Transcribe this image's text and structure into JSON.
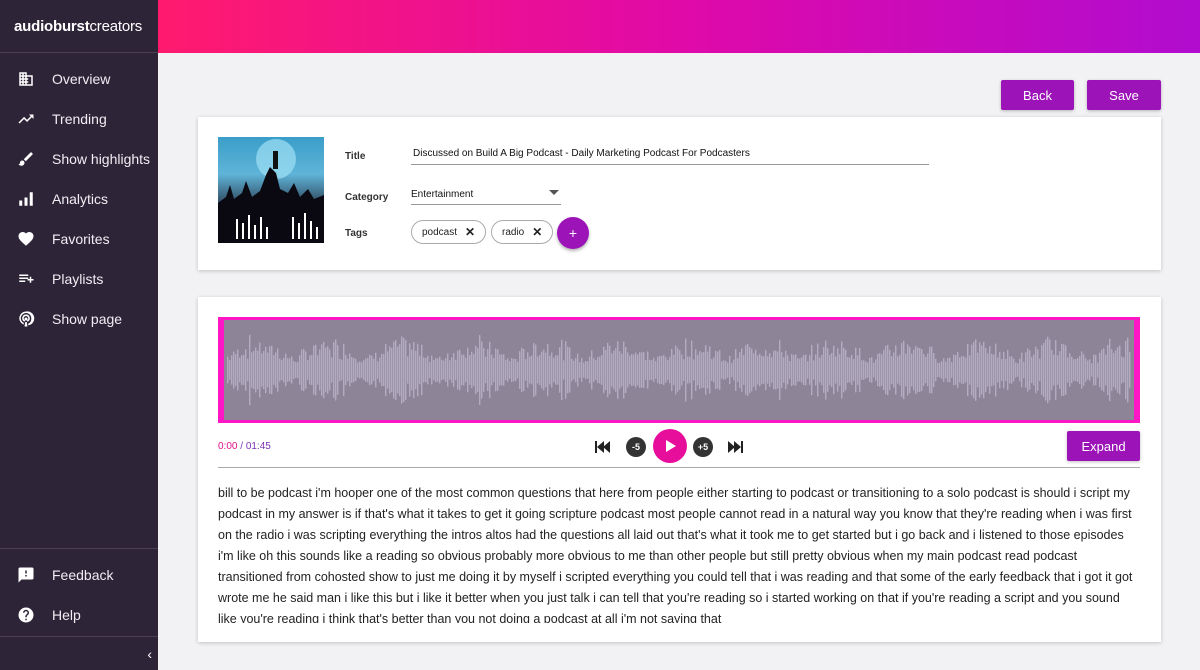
{
  "brand": {
    "name_bold": "audioburst",
    "name_light": "creators"
  },
  "sidebar": {
    "items": [
      {
        "label": "Overview",
        "icon": "building-icon"
      },
      {
        "label": "Trending",
        "icon": "trending-icon"
      },
      {
        "label": "Show highlights",
        "icon": "brush-icon"
      },
      {
        "label": "Analytics",
        "icon": "bar-chart-icon"
      },
      {
        "label": "Favorites",
        "icon": "heart-icon"
      },
      {
        "label": "Playlists",
        "icon": "playlist-add-icon"
      },
      {
        "label": "Show page",
        "icon": "podcast-icon"
      }
    ],
    "bottom": [
      {
        "label": "Feedback",
        "icon": "feedback-icon"
      },
      {
        "label": "Help",
        "icon": "help-icon"
      }
    ],
    "collapse_glyph": "‹"
  },
  "toolbar": {
    "back_label": "Back",
    "save_label": "Save"
  },
  "details": {
    "title_label": "Title",
    "title_value": "Discussed on Build A Big Podcast - Daily Marketing Podcast For Podcasters",
    "category_label": "Category",
    "category_value": "Entertainment",
    "tags_label": "Tags",
    "tags": [
      "podcast",
      "radio"
    ],
    "add_tag_glyph": "+"
  },
  "player": {
    "current_time": "0:00",
    "separator": " / ",
    "total_time": "01:45",
    "back_skip": "-5",
    "fwd_skip": "+5",
    "expand_label": "Expand"
  },
  "transcript": "bill to be podcast i'm hooper one of the most common questions that here from people either starting to podcast or transitioning to a solo podcast is should i script my podcast in my answer is if that's what it takes to get it going scripture podcast most people cannot read in a natural way you know that they're reading when i was first on the radio i was scripting everything the intros altos had the questions all laid out that's what it took me to get started but i go back and i listened to those episodes i'm like oh this sounds like a reading so obvious probably more obvious to me than other people but still pretty obvious when my main podcast read podcast transitioned from cohosted show to just me doing it by myself i scripted everything you could tell that i was reading and that some of the early feedback that i got it got wrote me he said man i like this but i like it better when you just talk i can tell that you're reading so i started working on that if you're reading a script and you sound like you're reading i think that's better than you not doing a podcast at all i'm not saying that",
  "colors": {
    "accent": "#9c14b8",
    "play": "#e60e9b",
    "wave_border": "#ff17c5",
    "sidebar_bg": "#2e2438"
  }
}
